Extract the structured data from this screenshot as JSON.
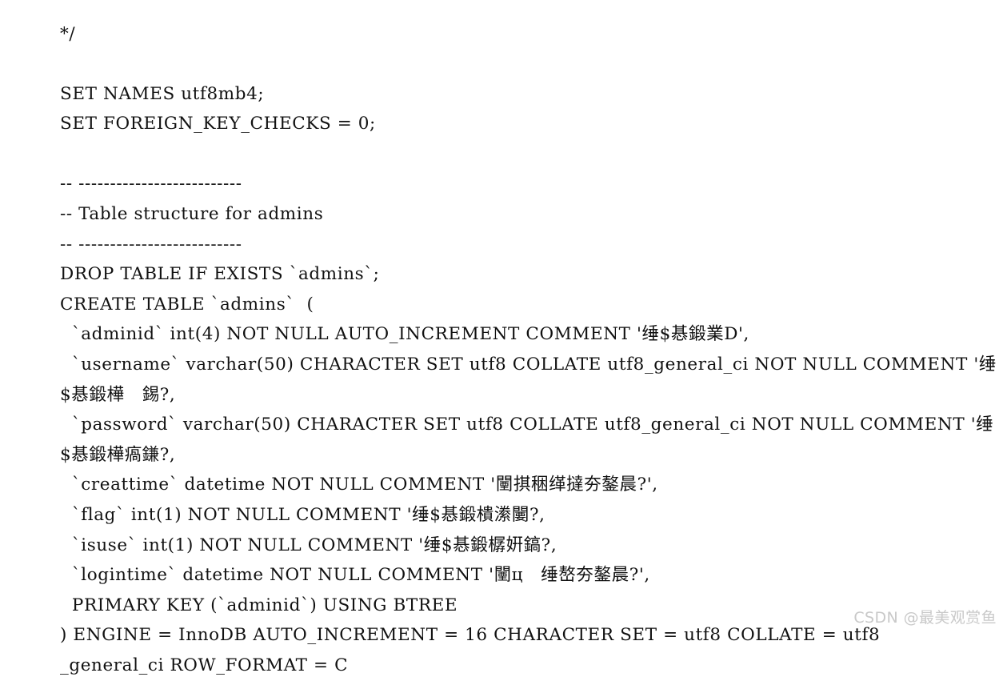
{
  "document": {
    "kind": "sql-dump-plaintext",
    "background_color": "#ffffff",
    "text_color": "#111111",
    "lines": [
      "*/",
      "",
      "SET NAMES utf8mb4;",
      "SET FOREIGN_KEY_CHECKS = 0;",
      "",
      "-- --------------------------",
      "-- Table structure for admins",
      "-- --------------------------",
      "DROP TABLE IF EXISTS `admins`;",
      "CREATE TABLE `admins`  (",
      "  `adminid` int(4) NOT NULL AUTO_INCREMENT COMMENT '缍$惎鍛業D',",
      "  `username` varchar(50) CHARACTER SET utf8 COLLATE utf8_general_ci NOT NULL COMMENT '缍$惎鍛樺　錫?,",
      "  `password` varchar(50) CHARACTER SET utf8 COLLATE utf8_general_ci NOT NULL COMMENT '缍$惎鍛樺瘑鎌?,",
      "  `creattime` datetime NOT NULL COMMENT '闉掑稇缂撻夯鏊晨?',",
      "  `flag` int(1) NOT NULL COMMENT '缍$惎鍛樻潫闄?,",
      "  `isuse` int(1) NOT NULL COMMENT '缍$惎鍛樼姸鎬?,",
      "  `logintime` datetime NOT NULL COMMENT '闉ц　缍嶅夯鏊晨?',",
      "  PRIMARY KEY (`adminid`) USING BTREE",
      ") ENGINE = InnoDB AUTO_INCREMENT = 16 CHARACTER SET = utf8 COLLATE = utf8",
      "_general_ci ROW_FORMAT = C"
    ]
  },
  "watermark": {
    "text": "CSDN @最美观赏鱼",
    "color": "#c9c9c9"
  }
}
